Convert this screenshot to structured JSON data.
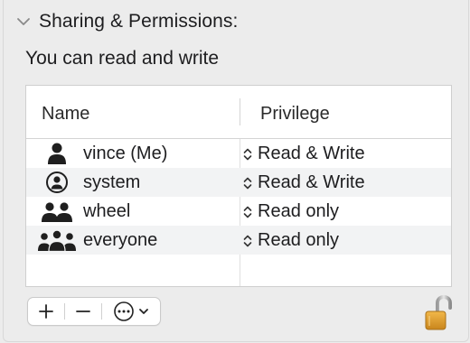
{
  "section": {
    "title": "Sharing & Permissions:",
    "expanded": true
  },
  "access": {
    "text": "You can read and write"
  },
  "table": {
    "columns": {
      "name": "Name",
      "privilege": "Privilege"
    },
    "rows": [
      {
        "name": "vince (Me)",
        "privilege": "Read & Write",
        "icon": "single-user-icon"
      },
      {
        "name": "system",
        "privilege": "Read & Write",
        "icon": "system-user-circle-icon"
      },
      {
        "name": "wheel",
        "privilege": "Read only",
        "icon": "two-users-icon"
      },
      {
        "name": "everyone",
        "privilege": "Read only",
        "icon": "group-users-icon"
      }
    ]
  },
  "toolbar": {
    "add_icon": "plus-icon",
    "remove_icon": "minus-icon",
    "action_icon": "ellipsis-circle-icon"
  },
  "lock": {
    "state": "unlocked",
    "icon": "unlocked-padlock-icon",
    "color": "#e0a030"
  }
}
